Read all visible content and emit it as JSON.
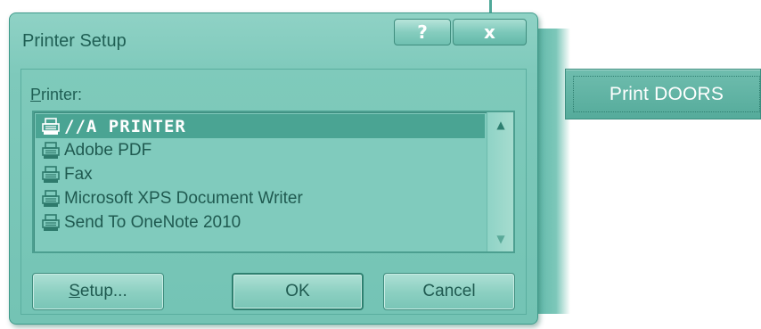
{
  "dialog": {
    "title": "Printer Setup",
    "help_label": "?",
    "close_label": "x"
  },
  "printer": {
    "label_accesskey": "P",
    "label_rest": "rinter:",
    "items": [
      {
        "name": "//A PRINTER",
        "selected": true
      },
      {
        "name": "Adobe PDF",
        "selected": false
      },
      {
        "name": "Fax",
        "selected": false
      },
      {
        "name": "Microsoft XPS Document Writer",
        "selected": false
      },
      {
        "name": "Send To OneNote 2010",
        "selected": false
      }
    ]
  },
  "buttons": {
    "setup_accesskey": "S",
    "setup_rest": "etup...",
    "ok": "OK",
    "cancel": "Cancel"
  },
  "side": {
    "print_doors": "Print DOORS"
  },
  "colors": {
    "teal": "#74c3b4",
    "selection": "#4aa493"
  }
}
